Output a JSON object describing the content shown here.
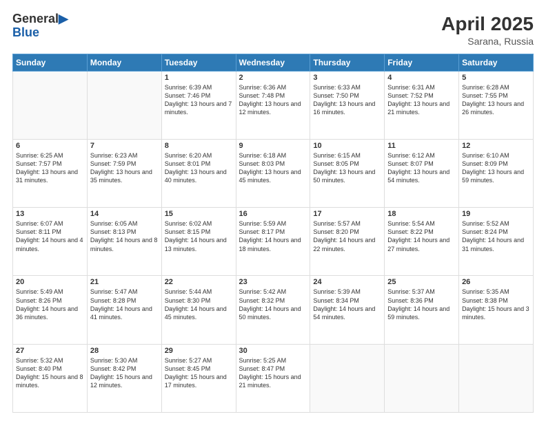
{
  "header": {
    "logo_general": "General",
    "logo_blue": "Blue",
    "month_title": "April 2025",
    "location": "Sarana, Russia"
  },
  "weekdays": [
    "Sunday",
    "Monday",
    "Tuesday",
    "Wednesday",
    "Thursday",
    "Friday",
    "Saturday"
  ],
  "weeks": [
    [
      {
        "day": "",
        "info": ""
      },
      {
        "day": "",
        "info": ""
      },
      {
        "day": "1",
        "info": "Sunrise: 6:39 AM\nSunset: 7:46 PM\nDaylight: 13 hours and 7 minutes."
      },
      {
        "day": "2",
        "info": "Sunrise: 6:36 AM\nSunset: 7:48 PM\nDaylight: 13 hours and 12 minutes."
      },
      {
        "day": "3",
        "info": "Sunrise: 6:33 AM\nSunset: 7:50 PM\nDaylight: 13 hours and 16 minutes."
      },
      {
        "day": "4",
        "info": "Sunrise: 6:31 AM\nSunset: 7:52 PM\nDaylight: 13 hours and 21 minutes."
      },
      {
        "day": "5",
        "info": "Sunrise: 6:28 AM\nSunset: 7:55 PM\nDaylight: 13 hours and 26 minutes."
      }
    ],
    [
      {
        "day": "6",
        "info": "Sunrise: 6:25 AM\nSunset: 7:57 PM\nDaylight: 13 hours and 31 minutes."
      },
      {
        "day": "7",
        "info": "Sunrise: 6:23 AM\nSunset: 7:59 PM\nDaylight: 13 hours and 35 minutes."
      },
      {
        "day": "8",
        "info": "Sunrise: 6:20 AM\nSunset: 8:01 PM\nDaylight: 13 hours and 40 minutes."
      },
      {
        "day": "9",
        "info": "Sunrise: 6:18 AM\nSunset: 8:03 PM\nDaylight: 13 hours and 45 minutes."
      },
      {
        "day": "10",
        "info": "Sunrise: 6:15 AM\nSunset: 8:05 PM\nDaylight: 13 hours and 50 minutes."
      },
      {
        "day": "11",
        "info": "Sunrise: 6:12 AM\nSunset: 8:07 PM\nDaylight: 13 hours and 54 minutes."
      },
      {
        "day": "12",
        "info": "Sunrise: 6:10 AM\nSunset: 8:09 PM\nDaylight: 13 hours and 59 minutes."
      }
    ],
    [
      {
        "day": "13",
        "info": "Sunrise: 6:07 AM\nSunset: 8:11 PM\nDaylight: 14 hours and 4 minutes."
      },
      {
        "day": "14",
        "info": "Sunrise: 6:05 AM\nSunset: 8:13 PM\nDaylight: 14 hours and 8 minutes."
      },
      {
        "day": "15",
        "info": "Sunrise: 6:02 AM\nSunset: 8:15 PM\nDaylight: 14 hours and 13 minutes."
      },
      {
        "day": "16",
        "info": "Sunrise: 5:59 AM\nSunset: 8:17 PM\nDaylight: 14 hours and 18 minutes."
      },
      {
        "day": "17",
        "info": "Sunrise: 5:57 AM\nSunset: 8:20 PM\nDaylight: 14 hours and 22 minutes."
      },
      {
        "day": "18",
        "info": "Sunrise: 5:54 AM\nSunset: 8:22 PM\nDaylight: 14 hours and 27 minutes."
      },
      {
        "day": "19",
        "info": "Sunrise: 5:52 AM\nSunset: 8:24 PM\nDaylight: 14 hours and 31 minutes."
      }
    ],
    [
      {
        "day": "20",
        "info": "Sunrise: 5:49 AM\nSunset: 8:26 PM\nDaylight: 14 hours and 36 minutes."
      },
      {
        "day": "21",
        "info": "Sunrise: 5:47 AM\nSunset: 8:28 PM\nDaylight: 14 hours and 41 minutes."
      },
      {
        "day": "22",
        "info": "Sunrise: 5:44 AM\nSunset: 8:30 PM\nDaylight: 14 hours and 45 minutes."
      },
      {
        "day": "23",
        "info": "Sunrise: 5:42 AM\nSunset: 8:32 PM\nDaylight: 14 hours and 50 minutes."
      },
      {
        "day": "24",
        "info": "Sunrise: 5:39 AM\nSunset: 8:34 PM\nDaylight: 14 hours and 54 minutes."
      },
      {
        "day": "25",
        "info": "Sunrise: 5:37 AM\nSunset: 8:36 PM\nDaylight: 14 hours and 59 minutes."
      },
      {
        "day": "26",
        "info": "Sunrise: 5:35 AM\nSunset: 8:38 PM\nDaylight: 15 hours and 3 minutes."
      }
    ],
    [
      {
        "day": "27",
        "info": "Sunrise: 5:32 AM\nSunset: 8:40 PM\nDaylight: 15 hours and 8 minutes."
      },
      {
        "day": "28",
        "info": "Sunrise: 5:30 AM\nSunset: 8:42 PM\nDaylight: 15 hours and 12 minutes."
      },
      {
        "day": "29",
        "info": "Sunrise: 5:27 AM\nSunset: 8:45 PM\nDaylight: 15 hours and 17 minutes."
      },
      {
        "day": "30",
        "info": "Sunrise: 5:25 AM\nSunset: 8:47 PM\nDaylight: 15 hours and 21 minutes."
      },
      {
        "day": "",
        "info": ""
      },
      {
        "day": "",
        "info": ""
      },
      {
        "day": "",
        "info": ""
      }
    ]
  ]
}
